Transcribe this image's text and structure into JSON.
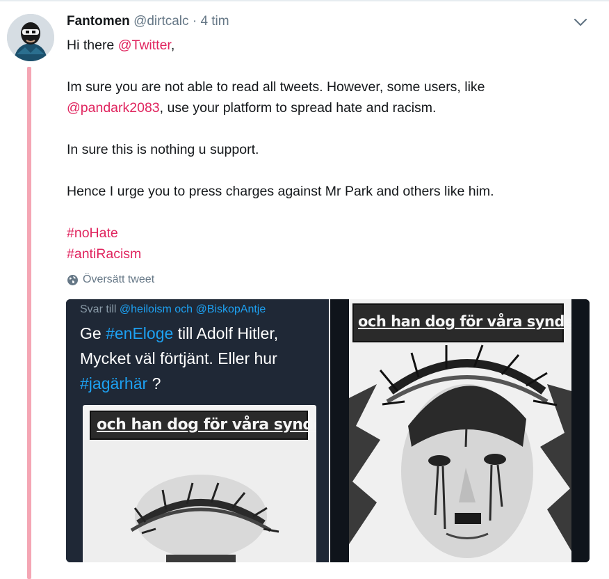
{
  "tweet": {
    "author_name": "Fantomen",
    "author_handle": "@dirtcalc",
    "separator": "·",
    "time": "4 tim",
    "line1_prefix": "Hi there ",
    "line1_mention": "@Twitter",
    "line1_suffix": ",",
    "line2": "Im sure you are not able to read all tweets. However, some users, like",
    "line3_mention": "@pandark2083",
    "line3_suffix": ", use your platform to spread hate and racism.",
    "line4": "In sure this is nothing u support.",
    "line5": "Hence I urge you to press charges against Mr Park and others like him.",
    "hashtag1": "#noHate",
    "hashtag2": "#antiRacism",
    "translate_label": "Översätt tweet"
  },
  "media": {
    "reply_prefix": "Svar till ",
    "reply_users": "@heiloism och @BiskopAntje",
    "quote_part1": "Ge ",
    "quote_tag1": "#enEloge",
    "quote_part2": " till Adolf Hitler, Mycket väl förtjänt. Eller hur ",
    "quote_tag2": "#jagärhär",
    "quote_part3": " ?",
    "poster_text": "och han dog för våra synder"
  },
  "colors": {
    "link": "#e0245e",
    "thread_line": "#f4a6b4",
    "secondary_text": "#657786",
    "dark_tweet_link": "#1da1f2"
  },
  "icons": {
    "caret": "chevron-down-icon",
    "translate": "globe-icon"
  }
}
